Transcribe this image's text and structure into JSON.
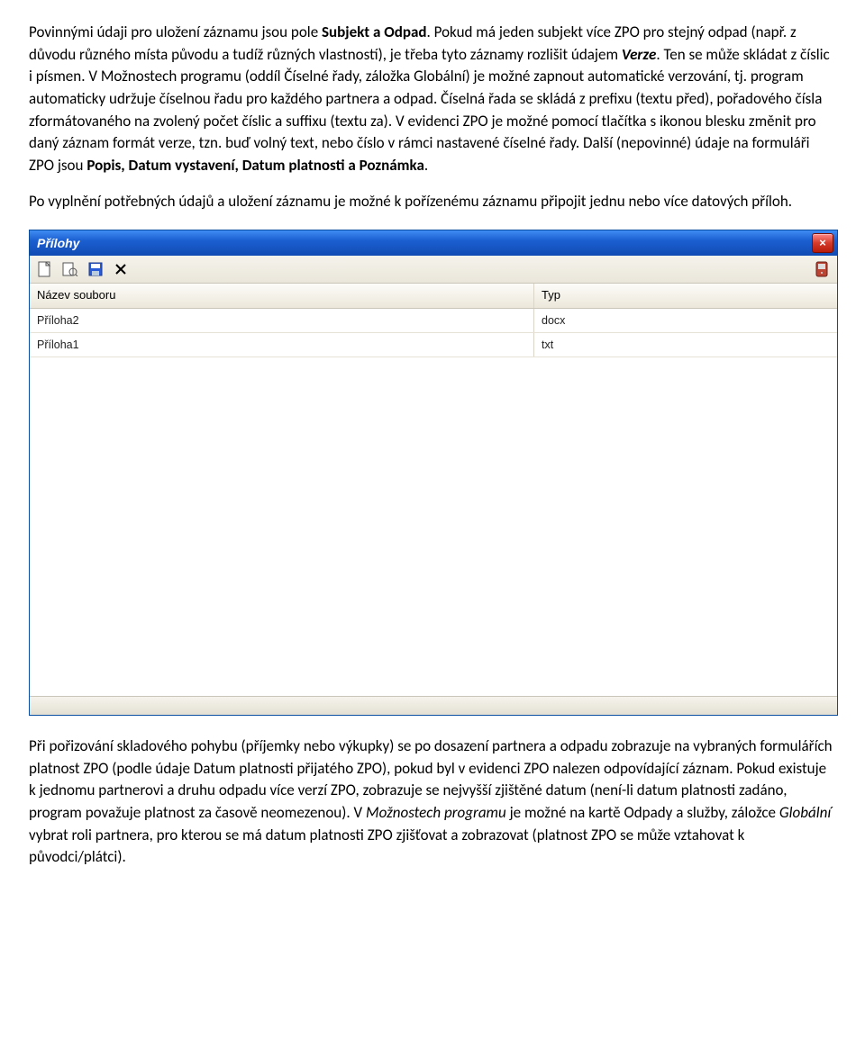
{
  "para1": {
    "a": "Povinnými údaji pro uložení záznamu jsou pole ",
    "b_strong": "Subjekt a Odpad",
    "c": ". Pokud má jeden subjekt více ZPO pro stejný odpad (např. z důvodu různého místa původu a tudíž různých vlastností), je třeba tyto záznamy rozlišit údajem ",
    "d_verze": "Verze",
    "e": ". Ten se může skládat z číslic i písmen. V Možnostech programu (oddíl Číselné řady, záložka Globální) je možné zapnout automatické verzování, tj. program automaticky udržuje číselnou řadu pro každého partnera a odpad. Číselná řada se skládá z prefixu (textu před), pořadového čísla zformátovaného na zvolený počet číslic a suffixu (textu za). V evidenci ZPO je možné pomocí tlačítka s ikonou blesku změnit pro daný záznam formát verze, tzn. buď volný text, nebo číslo v rámci nastavené číselné řady. Další (nepovinné) údaje na formuláři ZPO jsou ",
    "f_strong": "Popis, Datum vystavení, Datum platnosti a Poznámka",
    "g": "."
  },
  "para2": "Po vyplnění potřebných údajů a uložení záznamu je možné k pořízenému záznamu připojit jednu nebo více datových příloh.",
  "window": {
    "title": "Přílohy",
    "close": "×",
    "columns": {
      "name": "Název souboru",
      "type": "Typ"
    },
    "rows": [
      {
        "name": "Příloha2",
        "type": "docx"
      },
      {
        "name": "Příloha1",
        "type": "txt"
      }
    ]
  },
  "para3": {
    "a": "Při pořizování skladového pohybu (příjemky nebo výkupky) se po dosazení partnera a odpadu zobrazuje na vybraných formulářích platnost ZPO (podle údaje Datum platnosti přijatého ZPO), pokud byl v evidenci ZPO nalezen odpovídající záznam. Pokud existuje k jednomu partnerovi a druhu odpadu více verzí ZPO, zobrazuje se nejvyšší zjištěné datum (není-li datum platnosti zadáno, program považuje platnost za časově neomezenou). V ",
    "b_italic": "Možnostech programu",
    "c": " je možné na kartě Odpady a služby, záložce ",
    "d_italic": "Globální",
    "e": " vybrat roli partnera, pro kterou se má datum platnosti ZPO zjišťovat a zobrazovat (platnost ZPO se může vztahovat k původci/plátci)."
  }
}
